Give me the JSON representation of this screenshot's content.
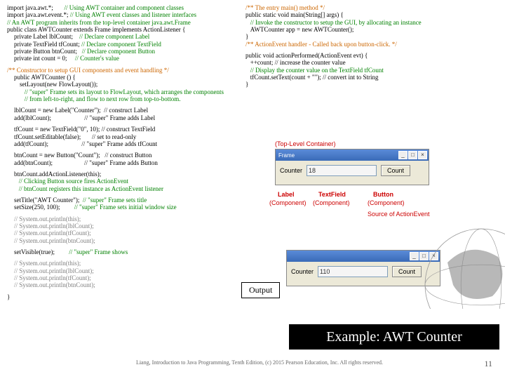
{
  "left": {
    "l01a": "import java.awt.*;       ",
    "l01b": "// Using AWT container and component classes",
    "l02a": "import java.awt.event.*; ",
    "l02b": "// Using AWT event classes and listener interfaces",
    "l03": "// An AWT program inherits from the top-level container java.awt.Frame",
    "l04": "public class AWTCounter extends Frame implements ActionListener {",
    "l05a": "private Label lblCount;    ",
    "l05b": "// Declare component Label",
    "l06a": "private TextField tfCount; ",
    "l06b": "// Declare component TextField",
    "l07a": "private Button btnCount;   ",
    "l07b": "// Declare component Button",
    "l08a": "private int count = 0;     ",
    "l08b": "// Counter's value",
    "ctor": "/** Constructor to setup GUI components and event handling */",
    "c01": "public AWTCounter () {",
    "c02": "setLayout(new FlowLayout());",
    "c03": "   // \"super\" Frame sets its layout to FlowLayout, which arranges the components",
    "c04": "   // from left-to-right, and flow to next row from top-to-bottom.",
    "lb1": "lblCount = new Label(\"Counter\");  // construct Label",
    "lb2": "add(lblCount);                     // \"super\" Frame adds Label",
    "tf1": "tfCount = new TextField(\"0\", 10); // construct TextField",
    "tf2": "tfCount.setEditable(false);       // set to read-only",
    "tf3": "add(tfCount);                     // \"super\" Frame adds tfCount",
    "bt1": "btnCount = new Button(\"Count\");   // construct Button",
    "bt2": "add(btnCount);                    // \"super\" Frame adds Button",
    "al1": "btnCount.addActionListener(this);",
    "al2": "   // Clicking Button source fires ActionEvent",
    "al3": "   // btnCount registers this instance as ActionEvent listener",
    "st1": "setTitle(\"AWT Counter\");  ",
    "st1b": "// \"super\" Frame sets title",
    "st2": "setSize(250, 100);         ",
    "st2b": "// \"super\" Frame sets initial window size",
    "so1": "// System.out.println(this);",
    "so2": "// System.out.println(lblCount);",
    "so3": "// System.out.println(tfCount);",
    "so4": "// System.out.println(btnCount);",
    "sv1": "setVisible(true);         ",
    "sv1b": "// \"super\" Frame shows",
    "so5": "// System.out.println(this);",
    "so6": "// System.out.println(lblCount);",
    "so7": "// System.out.println(tfCount);",
    "so8": "// System.out.println(btnCount);",
    "end": "}"
  },
  "right": {
    "m1": "/** The entry main() method */",
    "m2": "public static void main(String[] args) {",
    "m3": "   // Invoke the constructor to setup the GUI, by allocating an instance",
    "m4": "   AWTCounter app = new AWTCounter();",
    "m5": "}",
    "m6": "/** ActionEvent handler - Called back upon button-click. */",
    "a1": "public void actionPerformed(ActionEvent evt) {",
    "a2": "   ++count; // increase the counter value",
    "a3": "   // Display the counter value on the TextField tfCount",
    "a4": "   tfCount.setText(count + \"\"); // convert int to String",
    "a5": "}"
  },
  "win1": {
    "title": "Frame",
    "counter": "Counter",
    "value": "18",
    "btn": "Count",
    "ann_tl": "(Top-Level Container)",
    "ann_lbl": "Label",
    "ann_tf": "TextField",
    "ann_btn": "Button",
    "ann_c1": "(Component)",
    "ann_c2": "(Component)",
    "ann_c3": "(Component)",
    "ann_src": "Source of ActionEvent"
  },
  "win2": {
    "title": "",
    "counter": "Counter",
    "value": "110",
    "btn": "Count"
  },
  "icons": {
    "min": "_",
    "max": "□",
    "close": "×"
  },
  "output": "Output",
  "example": "Example: AWT Counter",
  "footer": "Liang, Introduction to Java Programming, Tenth Edition, (c) 2015 Pearson Education, Inc. All rights reserved.",
  "page": "11"
}
